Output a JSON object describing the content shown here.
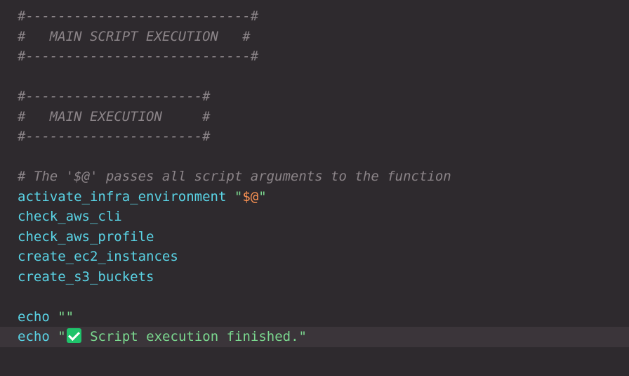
{
  "colors": {
    "background": "#2e2a2e",
    "current_line": "#3b353a",
    "comment": "#8b8488",
    "function": "#5ad4e6",
    "string": "#7bd88f",
    "variable": "#fd9353"
  },
  "code": {
    "header1_top": "#----------------------------#",
    "header1_title": "#   MAIN SCRIPT EXECUTION   #",
    "header1_bottom": "#----------------------------#",
    "header2_top": "#----------------------#",
    "header2_title": "#   MAIN EXECUTION     #",
    "header2_bottom": "#----------------------#",
    "comment_args": "# The '$@' passes all script arguments to the function",
    "call_activate": "activate_infra_environment",
    "call_activate_quote_open": "\"",
    "call_activate_arg": "$@",
    "call_activate_quote_close": "\"",
    "call_check_cli": "check_aws_cli",
    "call_check_profile": "check_aws_profile",
    "call_create_ec2": "create_ec2_instances",
    "call_create_s3": "create_s3_buckets",
    "echo_empty_cmd": "echo",
    "echo_empty_str": "\"\"",
    "echo_done_cmd": "echo",
    "echo_done_quote_open": "\"",
    "echo_done_icon": "white-check-mark-emoji",
    "echo_done_text": " Script execution finished.\""
  }
}
